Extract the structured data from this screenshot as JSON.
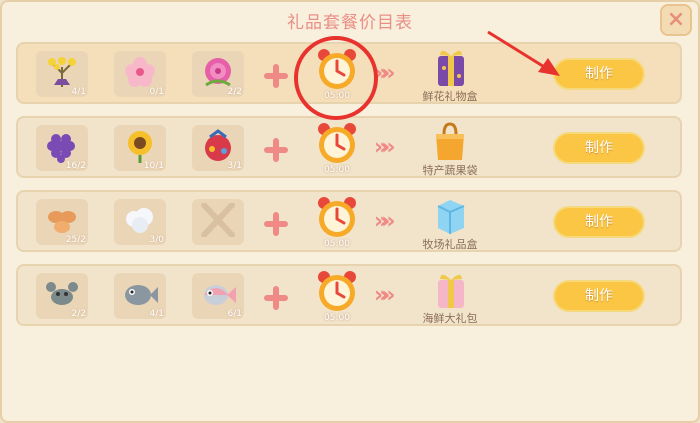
{
  "window": {
    "title": "礼品套餐价目表",
    "close_icon": "close-icon"
  },
  "recipes": [
    {
      "ingredients": [
        {
          "icon": "mimosa-flower-icon",
          "qty": "4/1"
        },
        {
          "icon": "pink-flower-icon",
          "qty": "0/1"
        },
        {
          "icon": "rose-icon",
          "qty": "2/2"
        }
      ],
      "time": "05:00",
      "gift_icon": "purple-gift-box-icon",
      "gift_name": "鲜花礼物盒",
      "button": "制作"
    },
    {
      "ingredients": [
        {
          "icon": "grapes-icon",
          "qty": "16/2"
        },
        {
          "icon": "sunflower-icon",
          "qty": "10/1"
        },
        {
          "icon": "berry-pouch-icon",
          "qty": "3/1"
        }
      ],
      "time": "05:00",
      "gift_icon": "orange-bag-icon",
      "gift_name": "特产蔬果袋",
      "button": "制作"
    },
    {
      "ingredients": [
        {
          "icon": "eggs-icon",
          "qty": "25/2"
        },
        {
          "icon": "wool-icon",
          "qty": "3/0"
        },
        {
          "icon": "empty-slot-x-icon",
          "qty": ""
        }
      ],
      "time": "05:00",
      "gift_icon": "ice-cube-box-icon",
      "gift_name": "牧场礼品盒",
      "button": "制作"
    },
    {
      "ingredients": [
        {
          "icon": "crab-icon",
          "qty": "2/2"
        },
        {
          "icon": "gray-fish-icon",
          "qty": "4/1"
        },
        {
          "icon": "pink-fish-icon",
          "qty": "6/1"
        }
      ],
      "time": "05:00",
      "gift_icon": "pink-gift-box-icon",
      "gift_name": "海鲜大礼包",
      "button": "制作"
    }
  ],
  "colors": {
    "accent": "#fbc644",
    "highlight": "#e8322d",
    "title": "#e98f86"
  }
}
